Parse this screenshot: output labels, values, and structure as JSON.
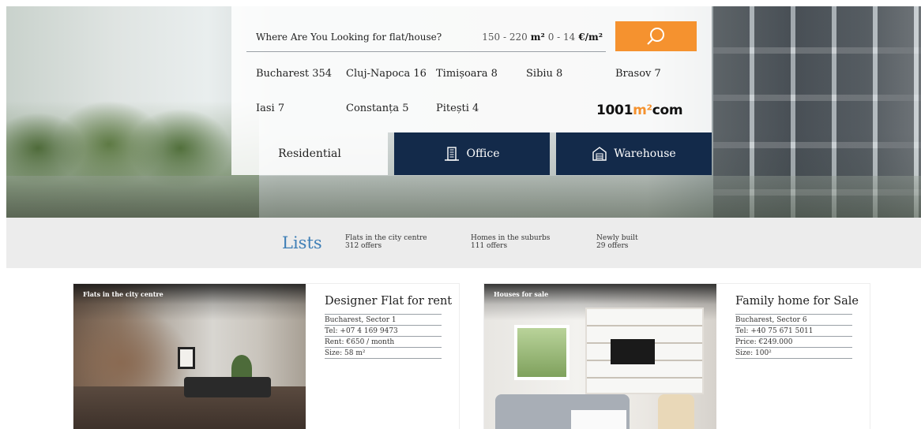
{
  "search": {
    "query_placeholder": "Where Are You Looking for flat/house?",
    "area_range": "150 - 220",
    "area_unit": "m²",
    "price_range": "0 - 14",
    "price_unit": "€/m²"
  },
  "cities": [
    {
      "label": "Bucharest 354"
    },
    {
      "label": "Cluj-Napoca 16"
    },
    {
      "label": "Timișoara 8"
    },
    {
      "label": "Sibiu 8"
    },
    {
      "label": "Brasov 7"
    },
    {
      "label": "Iasi 7"
    },
    {
      "label": "Constanța 5"
    },
    {
      "label": "Pitești 4"
    }
  ],
  "logo": {
    "prefix": "1001",
    "mark": "m²",
    "suffix": "com"
  },
  "tabs": {
    "residential": "Residential",
    "office": "Office",
    "warehouse": "Warehouse"
  },
  "lists": {
    "title": "Lists",
    "items": [
      {
        "name": "Flats in the city centre",
        "count": "312 offers"
      },
      {
        "name": "Homes in the suburbs",
        "count": "111 offers"
      },
      {
        "name": "Newly built",
        "count": "29 offers"
      }
    ]
  },
  "cards": [
    {
      "tag": "Flats in the city centre",
      "title": "Designer Flat for rent",
      "location": "Bucharest, Sector 1",
      "tel": "Tel: +07 4 169 9473",
      "price": "Rent: €650 / month",
      "size": "Size: 58 m²"
    },
    {
      "tag": "Houses for sale",
      "title": "Family home for Sale",
      "location": "Bucharest, Sector 6",
      "tel": "Tel: +40 75 671 5011",
      "price": "Price: €249.000",
      "size": "Size: 100²"
    }
  ],
  "colors": {
    "accent_orange": "#f5922f",
    "navy": "#132a4a",
    "lists_blue": "#3f7fb6"
  },
  "icons": {
    "search": "search-icon",
    "office": "office-building-icon",
    "warehouse": "warehouse-icon"
  }
}
